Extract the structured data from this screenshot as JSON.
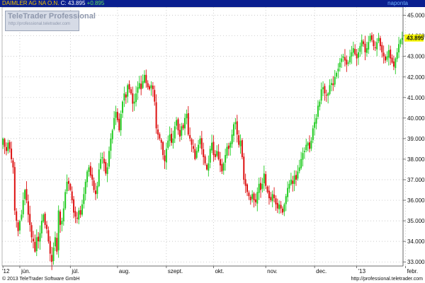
{
  "header": {
    "instrument": "DAIMLER AG NA O.N.",
    "price_label": "C: 43.895",
    "change_label": "+0.895",
    "period": "naponta"
  },
  "logo": {
    "name": "TeleTrader Professional",
    "url": "http://professional.teletrader.com"
  },
  "footer": {
    "copyright": "© 2013 TeleTrader Software GmbH",
    "link": "http://professional.teletrader.com"
  },
  "colors": {
    "up": "#22cc22",
    "down": "#dd1111",
    "grid": "#b8b8b8",
    "header_bg": "#0a1f8f",
    "last_price_bg": "#f5f500"
  },
  "chart_data": {
    "type": "candlestick",
    "last_price": 43.895,
    "ylim": [
      32.8,
      45.4
    ],
    "y_ticks": [
      33,
      34,
      35,
      36,
      37,
      38,
      39,
      40,
      41,
      42,
      43,
      44,
      45
    ],
    "y_tick_labels": [
      "33.000",
      "34.000",
      "35.000",
      "36.000",
      "37.000",
      "38.000",
      "39.000",
      "40.000",
      "41.000",
      "42.000",
      "43.000",
      "44.000",
      "45.000"
    ],
    "x_labels": [
      "'12",
      "jún.",
      "júl.",
      "aug.",
      "szept.",
      "okt.",
      "nov.",
      "dec.",
      "'13",
      "febr."
    ],
    "x_label_sessions": [
      0,
      10,
      40,
      68,
      97,
      125,
      156,
      185,
      210,
      239
    ],
    "close": [
      39.0,
      38.6,
      38.4,
      38.8,
      38.5,
      38.0,
      37.6,
      35.5,
      35.0,
      34.5,
      35.0,
      35.3,
      36.0,
      36.5,
      36.0,
      35.3,
      34.8,
      34.2,
      34.0,
      33.5,
      34.2,
      34.0,
      34.4,
      35.0,
      35.3,
      34.8,
      34.6,
      34.0,
      33.4,
      33.0,
      33.7,
      34.2,
      33.5,
      35.5,
      34.8,
      35.0,
      35.6,
      36.4,
      36.9,
      36.8,
      36.5,
      36.0,
      35.4,
      35.2,
      35.1,
      35.5,
      35.3,
      35.8,
      36.3,
      36.9,
      37.4,
      37.6,
      37.2,
      37.0,
      36.5,
      36.3,
      36.7,
      37.5,
      38.0,
      38.1,
      37.8,
      37.3,
      37.6,
      38.4,
      39.0,
      39.4,
      40.0,
      40.3,
      39.9,
      39.4,
      40.2,
      40.8,
      41.2,
      41.0,
      41.6,
      41.4,
      41.2,
      40.7,
      40.8,
      41.2,
      41.5,
      41.7,
      41.4,
      41.8,
      42.1,
      41.7,
      41.5,
      41.4,
      41.6,
      41.4,
      40.8,
      39.5,
      39.2,
      39.0,
      38.8,
      38.2,
      37.9,
      38.5,
      38.9,
      39.2,
      38.8,
      39.0,
      39.6,
      39.9,
      39.4,
      39.1,
      39.6,
      39.5,
      40.0,
      40.2,
      39.2,
      39.0,
      38.7,
      38.5,
      38.0,
      38.4,
      38.7,
      39.0,
      38.5,
      38.1,
      37.8,
      37.5,
      37.8,
      38.5,
      38.8,
      38.2,
      38.1,
      38.4,
      38.0,
      37.7,
      37.4,
      37.8,
      38.2,
      38.6,
      38.5,
      38.8,
      39.2,
      39.7,
      39.8,
      39.2,
      38.7,
      38.9,
      38.1,
      37.0,
      36.7,
      36.4,
      36.2,
      36.0,
      36.3,
      36.0,
      35.9,
      36.4,
      36.8,
      36.5,
      36.8,
      37.3,
      36.7,
      36.4,
      36.1,
      36.0,
      36.3,
      36.1,
      35.8,
      35.6,
      35.8,
      35.6,
      35.4,
      35.8,
      36.2,
      36.6,
      36.8,
      37.0,
      36.8,
      37.2,
      37.0,
      37.4,
      37.6,
      38.0,
      38.3,
      38.4,
      38.7,
      38.8,
      38.5,
      38.9,
      39.5,
      39.8,
      40.0,
      40.6,
      40.8,
      41.4,
      41.5,
      41.2,
      41.1,
      41.2,
      41.6,
      41.7,
      41.6,
      42.0,
      42.2,
      42.4,
      42.7,
      42.9,
      43.0,
      42.8,
      42.6,
      42.7,
      43.0,
      43.2,
      43.4,
      43.1,
      42.9,
      43.2,
      43.5,
      43.8,
      43.6,
      43.2,
      43.4,
      43.7,
      44.0,
      43.8,
      43.5,
      43.4,
      43.7,
      43.9,
      43.5,
      43.2,
      43.0,
      42.8,
      43.0,
      43.3,
      42.9,
      42.7,
      42.5,
      42.9,
      43.2,
      43.6,
      43.8,
      43.895
    ]
  }
}
